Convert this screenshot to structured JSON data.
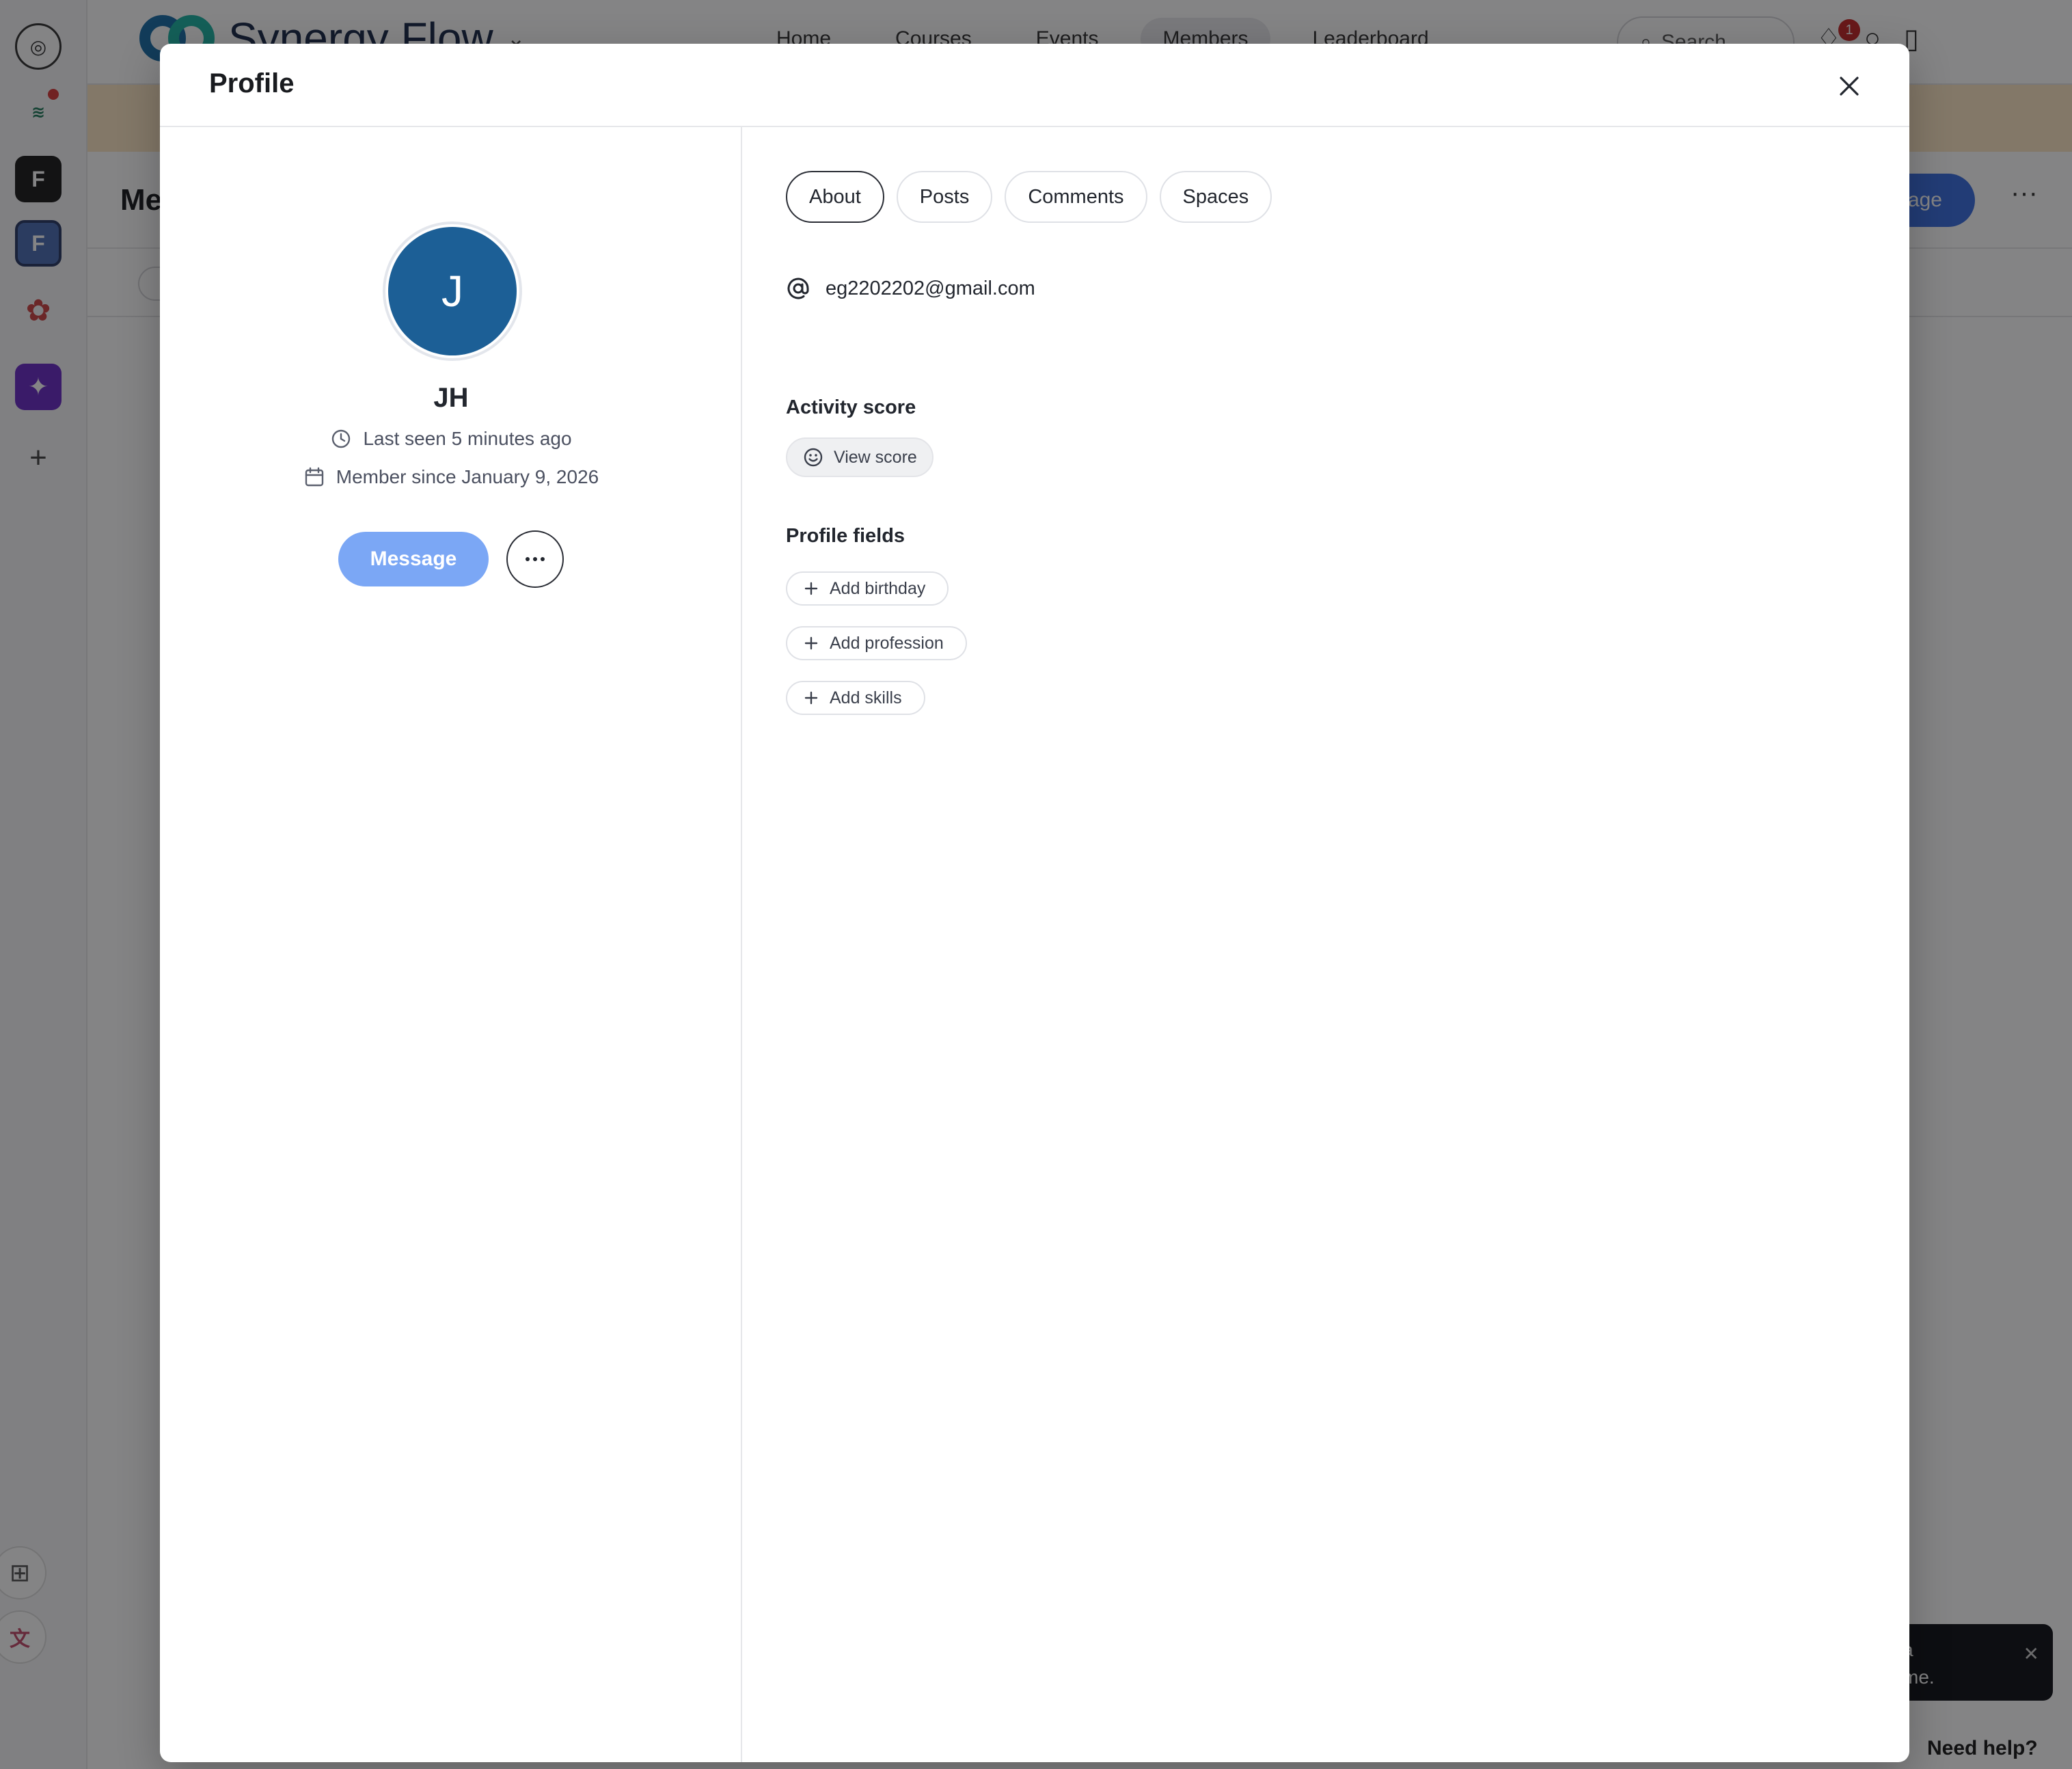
{
  "background": {
    "rail_items": [
      "F",
      "F"
    ],
    "brand": "Synergy Flow",
    "nav": [
      "Home",
      "Courses",
      "Events",
      "Members",
      "Leaderboard"
    ],
    "search_placeholder": "Search",
    "notification_count": "1",
    "page_title": "Me",
    "manage_label": "age",
    "toast_text_1": "a",
    "toast_text_2": "me.",
    "need_help": "Need help?"
  },
  "modal": {
    "title": "Profile",
    "member": {
      "avatar_initial": "J",
      "name": "JH",
      "last_seen": "Last seen 5 minutes ago",
      "member_since": "Member since January 9, 2026",
      "message_label": "Message"
    },
    "tabs": [
      "About",
      "Posts",
      "Comments",
      "Spaces"
    ],
    "active_tab": "About",
    "email": "eg2202202@gmail.com",
    "activity_score_title": "Activity score",
    "view_score_label": "View score",
    "profile_fields_title": "Profile fields",
    "fields": [
      "Add birthday",
      "Add profession",
      "Add skills"
    ]
  },
  "colors": {
    "avatar": "#1c5f96",
    "message_button": "#7ba7f5",
    "overlay": "rgba(10,10,12,0.5)"
  },
  "icons": {
    "close": "close-icon",
    "clock": "clock-icon",
    "calendar": "calendar-icon",
    "more": "more-horizontal-icon",
    "at": "at-sign-icon",
    "smile": "smile-icon",
    "plus": "plus-icon"
  }
}
